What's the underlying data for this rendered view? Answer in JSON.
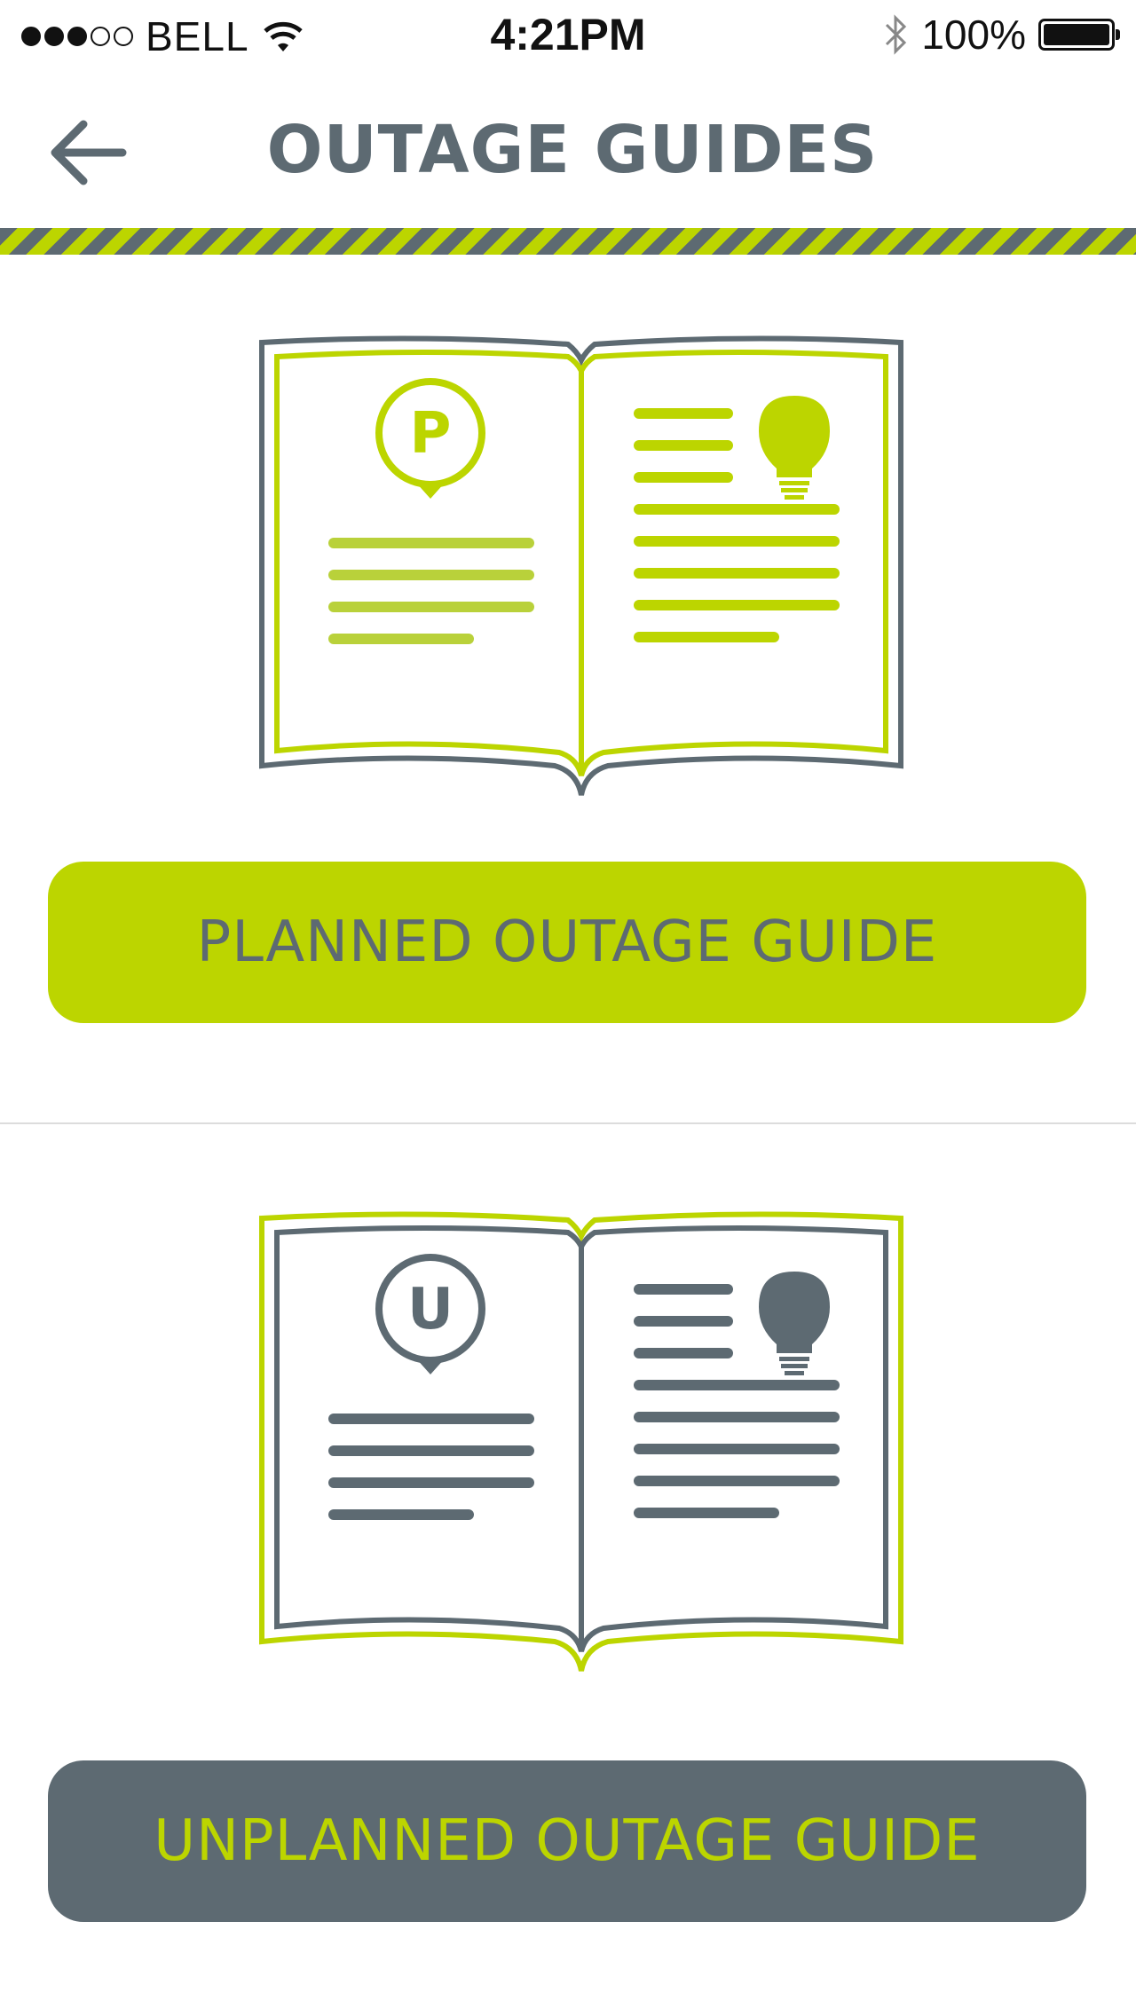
{
  "status_bar": {
    "carrier": "BELL",
    "time": "4:21PM",
    "battery": "100%"
  },
  "header": {
    "title": "OUTAGE GUIDES"
  },
  "guides": {
    "planned": {
      "label": "PLANNED OUTAGE GUIDE",
      "badge": "P"
    },
    "unplanned": {
      "label": "UNPLANNED OUTAGE GUIDE",
      "badge": "U"
    }
  },
  "colors": {
    "lime": "#bcd500",
    "slate": "#5d6a72",
    "background": "#ffffff"
  },
  "icons": [
    "back-arrow-icon",
    "wifi-icon",
    "bluetooth-icon",
    "battery-icon",
    "book-icon",
    "lightbulb-icon",
    "map-pin-icon"
  ]
}
